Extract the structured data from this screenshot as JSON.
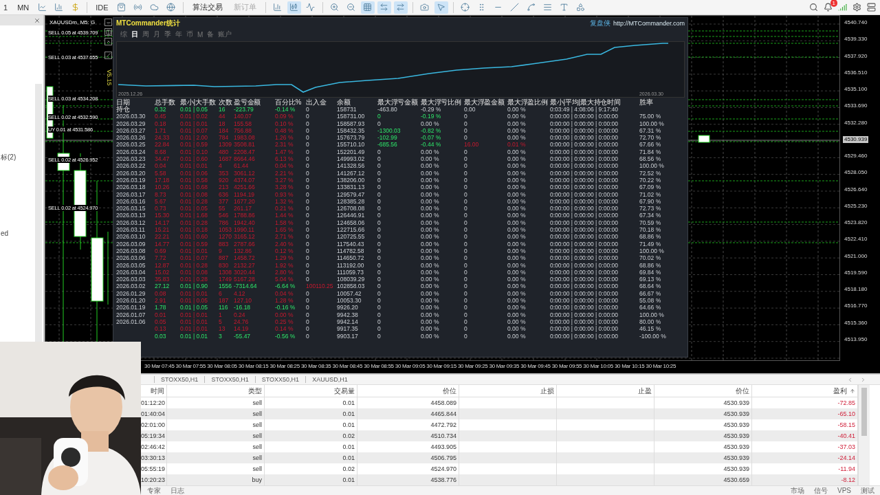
{
  "toolbar": {
    "items": [
      {
        "kind": "text",
        "label": "1"
      },
      {
        "kind": "text",
        "label": "MN"
      },
      {
        "kind": "icon",
        "selected": false
      },
      {
        "kind": "icon",
        "selected": false
      },
      {
        "kind": "icon",
        "selected": false
      },
      {
        "kind": "text",
        "label": "IDE"
      },
      {
        "kind": "icon",
        "selected": false
      },
      {
        "kind": "icon",
        "selected": false
      },
      {
        "kind": "icon",
        "selected": false
      },
      {
        "kind": "icon",
        "selected": false
      },
      {
        "kind": "action",
        "label": "算法交易",
        "disabled": false
      },
      {
        "kind": "action",
        "label": "新订单",
        "disabled": true
      },
      {
        "kind": "icon",
        "selected": false
      },
      {
        "kind": "icon",
        "selected": true
      },
      {
        "kind": "icon",
        "selected": false
      },
      {
        "kind": "icon",
        "selected": false
      },
      {
        "kind": "icon",
        "selected": false
      },
      {
        "kind": "icon",
        "selected": true
      },
      {
        "kind": "icon",
        "selected": true
      },
      {
        "kind": "icon",
        "selected": true
      },
      {
        "kind": "icon",
        "selected": false
      },
      {
        "kind": "icon",
        "selected": true
      },
      {
        "kind": "icon",
        "selected": false
      },
      {
        "kind": "icon",
        "selected": false
      },
      {
        "kind": "icon",
        "selected": false
      },
      {
        "kind": "icon",
        "selected": false
      },
      {
        "kind": "icon",
        "selected": false
      },
      {
        "kind": "icon",
        "selected": false
      },
      {
        "kind": "icon",
        "selected": false
      },
      {
        "kind": "icon",
        "selected": false
      }
    ],
    "notifications": "1"
  },
  "navigator": {
    "items": [
      "标(2)",
      "ed"
    ]
  },
  "chart": {
    "symbol": "XAUUSDm, M5: G",
    "version": "V5.15",
    "orders": [
      "SELL 0.05 at 4539.709",
      "SELL 0.03 at 4537.655",
      "SELL 0.03 at 4534.208",
      "SELL 0.02 at 4532.590",
      "UY 0.01 at 4531.586",
      "SELL 0.02 at 4526.952",
      "SELL 0.02 at 4524.970"
    ],
    "prices": [
      {
        "label": "4540.740",
        "current": false
      },
      {
        "label": "4539.330",
        "current": false
      },
      {
        "label": "4537.920",
        "current": false
      },
      {
        "label": "4536.510",
        "current": false
      },
      {
        "label": "4535.100",
        "current": false
      },
      {
        "label": "4533.690",
        "current": false
      },
      {
        "label": "4532.280",
        "current": false
      },
      {
        "label": "4530.939",
        "current": true
      },
      {
        "label": "4529.460",
        "current": false
      },
      {
        "label": "4528.050",
        "current": false
      },
      {
        "label": "4526.640",
        "current": false
      },
      {
        "label": "4525.230",
        "current": false
      },
      {
        "label": "4523.820",
        "current": false
      },
      {
        "label": "4522.410",
        "current": false
      },
      {
        "label": "4521.000",
        "current": false
      },
      {
        "label": "4519.590",
        "current": false
      },
      {
        "label": "4518.180",
        "current": false
      },
      {
        "label": "4516.770",
        "current": false
      },
      {
        "label": "4515.360",
        "current": false
      },
      {
        "label": "4513.950",
        "current": false
      }
    ],
    "times": [
      "30 Mar 07:45",
      "30 Mar 07:55",
      "30 Mar 08:05",
      "30 Mar 08:15",
      "30 Mar 08:25",
      "30 Mar 08:35",
      "30 Mar 08:45",
      "30 Mar 08:55",
      "30 Mar 09:05",
      "30 Mar 09:15",
      "30 Mar 09:25",
      "30 Mar 09:35",
      "30 Mar 09:45",
      "30 Mar 09:55",
      "30 Mar 10:05",
      "30 Mar 10:15",
      "30 Mar 10:25"
    ]
  },
  "stats": {
    "title": "MTCommander统计",
    "brand": "复盘侠",
    "link": "http://MTCommander.com",
    "tabs": [
      {
        "label": "综",
        "selected": false
      },
      {
        "label": "日",
        "selected": true
      },
      {
        "label": "周",
        "selected": false
      },
      {
        "label": "月",
        "selected": false
      },
      {
        "label": "季",
        "selected": false
      },
      {
        "label": "年",
        "selected": false
      },
      {
        "label": "币",
        "selected": false
      },
      {
        "label": "M",
        "selected": false
      },
      {
        "label": "备",
        "selected": false
      },
      {
        "label": "账户",
        "selected": false
      }
    ],
    "chart_start": "2025.12.26",
    "chart_end": "2026.03.30",
    "columns": [
      "日期",
      "总手数",
      "最小|大手数",
      "次数",
      "盈亏金额",
      "百分比%",
      "出入金",
      "余额",
      "最大浮亏金额",
      "最大浮亏比例",
      "最大浮盈金额",
      "最大浮盈比例",
      "最小|平均|最大持仓时间",
      "胜率"
    ],
    "rows": [
      {
        "date": "持仓",
        "kind": "loss",
        "values": [
          "0.32",
          "0.01 | 0.05",
          "16",
          "-223.79",
          "-0.14 %",
          "0",
          "158731",
          "-463.80",
          "-0.29 %",
          "0.00",
          "0.00 %",
          "0:03:49 | 4:08:06 | 9:17:40"
        ]
      },
      {
        "date": "2026.03.30",
        "kind": "profit",
        "float_marked": true,
        "values": [
          "0.45",
          "0.01 | 0.02",
          "44",
          "140.07",
          "0.09 %",
          "0",
          "158731.00",
          "0",
          "-0.19 %",
          "0",
          "0.00 %",
          "0:00:00 | 0:00:00 | 0:00:00",
          "75.00 %"
        ]
      },
      {
        "date": "2026.03.29",
        "kind": "profit",
        "values": [
          "0.18",
          "0.01 | 0.01",
          "18",
          "155.58",
          "0.10 %",
          "0",
          "158587.93",
          "0",
          "0.00 %",
          "0",
          "0.00 %",
          "0:00:00 | 0:00:00 | 0:00:00",
          "100.00 %"
        ]
      },
      {
        "date": "2026.03.27",
        "kind": "profit",
        "float_marked": true,
        "values": [
          "1.71",
          "0.01 | 0.07",
          "184",
          "756.88",
          "0.48 %",
          "0",
          "158432.35",
          "-1300.03",
          "-0.82 %",
          "0",
          "0.00 %",
          "0:00:00 | 0:00:00 | 0:00:00",
          "67.31 %"
        ]
      },
      {
        "date": "2026.03.26",
        "kind": "profit",
        "float_marked": true,
        "values": [
          "24.33",
          "0.01 | 2.00",
          "784",
          "1983.08",
          "1.26 %",
          "0",
          "157673.79",
          "-102.99",
          "-0.07 %",
          "0",
          "0.00 %",
          "0:00:00 | 0:00:00 | 0:00:00",
          "72.70 %"
        ]
      },
      {
        "date": "2026.03.25",
        "kind": "profit",
        "float_marked": true,
        "values": [
          "22.84",
          "0.01 | 0.59",
          "1309",
          "3508.81",
          "2.31 %",
          "0",
          "155710.10",
          "-685.56",
          "-0.44 %",
          "16.00",
          "0.01 %",
          "0:00:00 | 0:00:00 | 0:00:00",
          "67.66 %"
        ]
      },
      {
        "date": "2026.03.24",
        "kind": "profit",
        "values": [
          "8.68",
          "0.01 | 0.10",
          "480",
          "2208.47",
          "1.47 %",
          "0",
          "152201.49",
          "0",
          "0.00 %",
          "0",
          "0.00 %",
          "0:00:00 | 0:00:00 | 0:00:00",
          "71.84 %"
        ]
      },
      {
        "date": "2026.03.23",
        "kind": "profit",
        "values": [
          "34.47",
          "0.01 | 0.60",
          "1687",
          "8664.46",
          "6.13 %",
          "0",
          "149993.02",
          "0",
          "0.00 %",
          "0",
          "0.00 %",
          "0:00:00 | 0:00:00 | 0:00:00",
          "68.56 %"
        ]
      },
      {
        "date": "2026.03.22",
        "kind": "profit",
        "values": [
          "0.04",
          "0.01 | 0.01",
          "4",
          "61.44",
          "0.04 %",
          "0",
          "141328.56",
          "0",
          "0.00 %",
          "0",
          "0.00 %",
          "0:00:00 | 0:00:00 | 0:00:00",
          "100.00 %"
        ]
      },
      {
        "date": "2026.03.20",
        "kind": "profit",
        "values": [
          "5.58",
          "0.01 | 0.06",
          "353",
          "3061.12",
          "2.21 %",
          "0",
          "141267.12",
          "0",
          "0.00 %",
          "0",
          "0.00 %",
          "0:00:00 | 0:00:00 | 0:00:00",
          "72.52 %"
        ]
      },
      {
        "date": "2026.03.19",
        "kind": "profit",
        "values": [
          "17.18",
          "0.01 | 0.58",
          "920",
          "4374.07",
          "3.27 %",
          "0",
          "138206.00",
          "0",
          "0.00 %",
          "0",
          "0.00 %",
          "0:00:00 | 0:00:00 | 0:00:00",
          "70.22 %"
        ]
      },
      {
        "date": "2026.03.18",
        "kind": "profit",
        "values": [
          "10.26",
          "0.01 | 0.68",
          "213",
          "4251.66",
          "3.28 %",
          "0",
          "133831.13",
          "0",
          "0.00 %",
          "0",
          "0.00 %",
          "0:00:00 | 0:00:00 | 0:00:00",
          "67.09 %"
        ]
      },
      {
        "date": "2026.03.17",
        "kind": "profit",
        "values": [
          "8.73",
          "0.01 | 0.08",
          "636",
          "1194.19",
          "0.93 %",
          "0",
          "129579.47",
          "0",
          "0.00 %",
          "0",
          "0.00 %",
          "0:00:00 | 0:00:00 | 0:00:00",
          "71.02 %"
        ]
      },
      {
        "date": "2026.03.16",
        "kind": "profit",
        "values": [
          "5.67",
          "0.01 | 0.28",
          "377",
          "1677.20",
          "1.32 %",
          "0",
          "128385.28",
          "0",
          "0.00 %",
          "0",
          "0.00 %",
          "0:00:00 | 0:00:00 | 0:00:00",
          "67.90 %"
        ]
      },
      {
        "date": "2026.03.15",
        "kind": "profit",
        "values": [
          "0.73",
          "0.01 | 0.05",
          "55",
          "261.17",
          "0.21 %",
          "0",
          "126708.08",
          "0",
          "0.00 %",
          "0",
          "0.00 %",
          "0:00:00 | 0:00:00 | 0:00:00",
          "72.73 %"
        ]
      },
      {
        "date": "2026.03.13",
        "kind": "profit",
        "values": [
          "15.30",
          "0.01 | 1.68",
          "546",
          "1788.86",
          "1.44 %",
          "0",
          "126446.91",
          "0",
          "0.00 %",
          "0",
          "0.00 %",
          "0:00:00 | 0:00:00 | 0:00:00",
          "67.34 %"
        ]
      },
      {
        "date": "2026.03.12",
        "kind": "profit",
        "values": [
          "14.17",
          "0.01 | 0.28",
          "786",
          "1942.40",
          "1.58 %",
          "0",
          "124658.06",
          "0",
          "0.00 %",
          "0",
          "0.00 %",
          "0:00:00 | 0:00:00 | 0:00:00",
          "70.59 %"
        ]
      },
      {
        "date": "2026.03.11",
        "kind": "profit",
        "values": [
          "15.21",
          "0.01 | 0.18",
          "1053",
          "1990.11",
          "1.65 %",
          "0",
          "122715.66",
          "0",
          "0.00 %",
          "0",
          "0.00 %",
          "0:00:00 | 0:00:00 | 0:00:00",
          "70.18 %"
        ]
      },
      {
        "date": "2026.03.10",
        "kind": "profit",
        "values": [
          "22.21",
          "0.01 | 0.60",
          "1270",
          "3165.12",
          "2.71 %",
          "0",
          "120725.55",
          "0",
          "0.00 %",
          "0",
          "0.00 %",
          "0:00:00 | 0:00:00 | 0:00:00",
          "68.86 %"
        ]
      },
      {
        "date": "2026.03.09",
        "kind": "profit",
        "values": [
          "14.77",
          "0.01 | 0.59",
          "883",
          "2787.66",
          "2.40 %",
          "0",
          "117540.43",
          "0",
          "0.00 %",
          "0",
          "0.00 %",
          "0:00:00 | 0:00:00 | 0:00:00",
          "71.49 %"
        ]
      },
      {
        "date": "2026.03.08",
        "kind": "profit",
        "values": [
          "0.69",
          "0.01 | 0.01",
          "9",
          "132.86",
          "0.12 %",
          "0",
          "114782.58",
          "0",
          "0.00 %",
          "0",
          "0.00 %",
          "0:00:00 | 0:00:00 | 0:00:00",
          "100.00 %"
        ]
      },
      {
        "date": "2026.03.06",
        "kind": "profit",
        "values": [
          "7.72",
          "0.01 | 0.07",
          "887",
          "1458.72",
          "1.29 %",
          "0",
          "114650.72",
          "0",
          "0.00 %",
          "0",
          "0.00 %",
          "0:00:00 | 0:00:00 | 0:00:00",
          "70.02 %"
        ]
      },
      {
        "date": "2026.03.05",
        "kind": "profit",
        "values": [
          "12.87",
          "0.01 | 0.28",
          "830",
          "2132.27",
          "1.92 %",
          "0",
          "113192.00",
          "0",
          "0.00 %",
          "0",
          "0.00 %",
          "0:00:00 | 0:00:00 | 0:00:00",
          "68.86 %"
        ]
      },
      {
        "date": "2026.03.04",
        "kind": "profit",
        "values": [
          "15.02",
          "0.01 | 0.08",
          "1308",
          "3020.44",
          "2.80 %",
          "0",
          "111059.73",
          "0",
          "0.00 %",
          "0",
          "0.00 %",
          "0:00:00 | 0:00:00 | 0:00:00",
          "69.84 %"
        ]
      },
      {
        "date": "2026.03.03",
        "kind": "profit",
        "values": [
          "35.83",
          "0.01 | 0.28",
          "1749",
          "5167.28",
          "5.04 %",
          "0",
          "108039.29",
          "0",
          "0.00 %",
          "0",
          "0.00 %",
          "0:00:00 | 0:00:00 | 0:00:00",
          "69.13 %"
        ]
      },
      {
        "date": "2026.03.02",
        "kind": "loss",
        "deposit_marked": true,
        "values": [
          "27.12",
          "0.01 | 0.90",
          "1556",
          "-7314.64",
          "-6.64 %",
          "100110.25",
          "102858.03",
          "0",
          "0.00 %",
          "0",
          "0.00 %",
          "0:00:00 | 0:00:00 | 0:00:00",
          "68.64 %"
        ]
      },
      {
        "date": "2026.01.29",
        "kind": "profit",
        "values": [
          "0.08",
          "0.01 | 0.01",
          "6",
          "4.12",
          "0.04 %",
          "0",
          "10057.42",
          "0",
          "0.00 %",
          "0",
          "0.00 %",
          "0:00:00 | 0:00:00 | 0:00:00",
          "66.67 %"
        ]
      },
      {
        "date": "2026.01.20",
        "kind": "profit",
        "values": [
          "2.91",
          "0.01 | 0.05",
          "187",
          "127.10",
          "1.28 %",
          "0",
          "10053.30",
          "0",
          "0.00 %",
          "0",
          "0.00 %",
          "0:00:00 | 0:00:00 | 0:00:00",
          "55.08 %"
        ]
      },
      {
        "date": "2026.01.19",
        "kind": "loss",
        "values": [
          "1.78",
          "0.01 | 0.05",
          "116",
          "-16.18",
          "-0.16 %",
          "0",
          "9926.20",
          "0",
          "0.00 %",
          "0",
          "0.00 %",
          "0:00:00 | 0:00:00 | 0:00:00",
          "64.66 %"
        ]
      },
      {
        "date": "2026.01.07",
        "kind": "profit",
        "values": [
          "0.01",
          "0.01 | 0.01",
          "1",
          "0.24",
          "0.00 %",
          "0",
          "9942.38",
          "0",
          "0.00 %",
          "0",
          "0.00 %",
          "0:00:00 | 0:00:00 | 0:00:00",
          "100.00 %"
        ]
      },
      {
        "date": "2026.01.06",
        "kind": "profit",
        "values": [
          "0.05",
          "0.01 | 0.01",
          "5",
          "24.76",
          "0.25 %",
          "0",
          "9942.14",
          "0",
          "0.00 %",
          "0",
          "0.00 %",
          "0:00:00 | 0:00:00 | 0:00:00",
          "80.00 %"
        ]
      },
      {
        "kind": "profit",
        "values": [
          "0.13",
          "0.01 | 0.01",
          "13",
          "14.19",
          "0.14 %",
          "0",
          "9917.35",
          "0",
          "0.00 %",
          "0",
          "0.00 %",
          "0:00:00 | 0:00:00 | 0:00:00",
          "46.15 %"
        ]
      },
      {
        "kind": "loss",
        "values": [
          "0.03",
          "0.01 | 0.01",
          "3",
          "-55.47",
          "-0.56 %",
          "0",
          "9903.17",
          "0",
          "0.00 %",
          "0",
          "0.00 %",
          "0:00:00 | 0:00:00 | 0:00:00",
          "-100.00 %"
        ]
      }
    ]
  },
  "bottom": {
    "tabs": [
      "STOXX50,H1",
      "STOXX50,H1",
      "STOXX50,H1",
      "XAUUSD,H1"
    ],
    "columns": [
      "时间",
      "类型",
      "交易量",
      "价位",
      "止损",
      "止盈",
      "价位",
      "盈利"
    ],
    "rows": [
      [
        "01:12:20",
        "sell",
        "0.01",
        "4458.089",
        "",
        "",
        "4530.939",
        "-72.85"
      ],
      [
        "01:40:04",
        "sell",
        "0.01",
        "4465.844",
        "",
        "",
        "4530.939",
        "-65.10"
      ],
      [
        "02:01:00",
        "sell",
        "0.01",
        "4472.792",
        "",
        "",
        "4530.939",
        "-58.15"
      ],
      [
        "05:19:34",
        "sell",
        "0.02",
        "4510.734",
        "",
        "",
        "4530.939",
        "-40.41"
      ],
      [
        "02:46:42",
        "sell",
        "0.01",
        "4493.905",
        "",
        "",
        "4530.939",
        "-37.03"
      ],
      [
        "03:30:13",
        "sell",
        "0.01",
        "4506.795",
        "",
        "",
        "4530.939",
        "-24.14"
      ],
      [
        "05:55:19",
        "sell",
        "0.02",
        "4524.970",
        "",
        "",
        "4530.939",
        "-11.94"
      ],
      [
        "10:20:23",
        "buy",
        "0.01",
        "4538.776",
        "",
        "",
        "4530.659",
        "-8.12"
      ]
    ],
    "status_left": [
      "专家",
      "日志"
    ],
    "status_right": [
      "市场",
      "信号",
      "VPS",
      "测试"
    ]
  }
}
